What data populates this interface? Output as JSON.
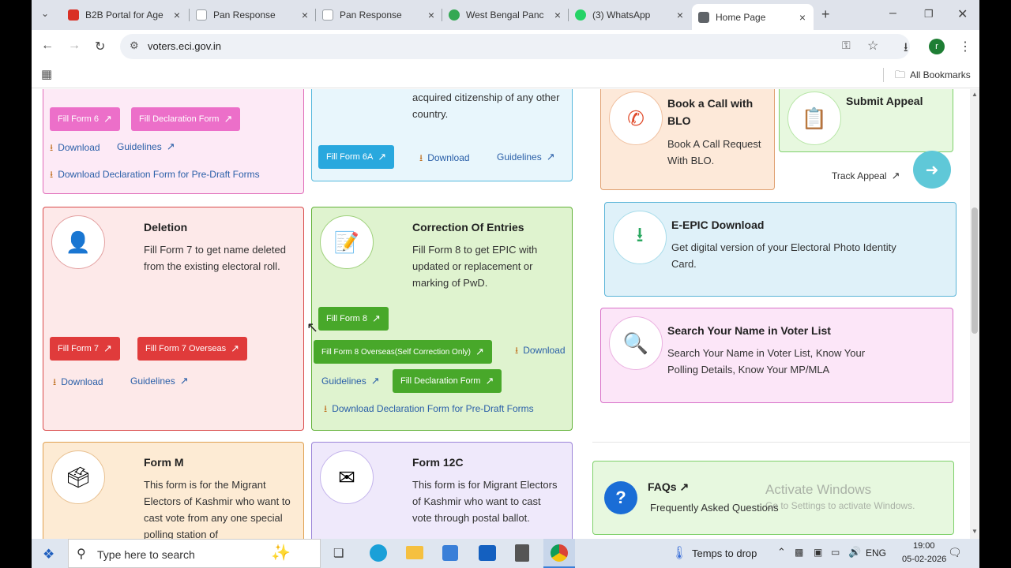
{
  "browser": {
    "tabs": [
      {
        "title": "B2B Portal for Age",
        "color": "#d93025"
      },
      {
        "title": "Pan Response",
        "color": "#9aa0a6"
      },
      {
        "title": "Pan Response",
        "color": "#9aa0a6"
      },
      {
        "title": "West Bengal Panc",
        "color": "#34a853"
      },
      {
        "title": "(3) WhatsApp",
        "color": "#25d366"
      },
      {
        "title": "Home Page",
        "color": "#5f6368"
      }
    ],
    "url": "voters.eci.gov.in",
    "bookmarks_label": "All Bookmarks",
    "profile_initial": "r"
  },
  "cards": {
    "form6": {
      "btn1": "Fill Form 6",
      "btn2": "Fill Declaration Form",
      "download": "Download",
      "guidelines": "Guidelines",
      "decl_download": "Download Declaration Form for Pre-Draft Forms"
    },
    "form6a": {
      "desc": "citizen of India and has not acquired citizenship of any other country.",
      "btn": "Fill Form 6A",
      "download": "Download",
      "guidelines": "Guidelines"
    },
    "deletion": {
      "title": "Deletion",
      "desc": "Fill Form 7 to get name deleted from the existing electoral roll.",
      "btn1": "Fill Form 7",
      "btn2": "Fill Form 7 Overseas",
      "download": "Download",
      "guidelines": "Guidelines"
    },
    "correction": {
      "title": "Correction Of Entries",
      "desc": "Fill Form 8 to get EPIC with updated or replacement or marking of PwD.",
      "btn1": "Fill Form 8",
      "btn2": "Fill Form 8 Overseas(Self Correction Only)",
      "download": "Download",
      "guidelines": "Guidelines",
      "btn3": "Fill Declaration Form",
      "decl_download": "Download Declaration Form for Pre-Draft Forms"
    },
    "formm": {
      "title": "Form M",
      "desc": "This form is for the Migrant Electors of Kashmir who want to cast vote from any one special polling station of"
    },
    "form12c": {
      "title": "Form 12C",
      "desc": "This form is for Migrant Electors of Kashmir who want to cast vote through postal ballot."
    },
    "blo": {
      "title": "Book a Call with BLO",
      "desc": "Book A Call Request With BLO."
    },
    "appeal": {
      "title": "Submit Appeal",
      "track": "Track Appeal"
    },
    "epic": {
      "title": "E-EPIC Download",
      "desc": "Get digital version of your Electoral Photo Identity Card."
    },
    "search": {
      "title": "Search Your Name in Voter List",
      "desc": "Search Your Name in Voter List, Know Your Polling Details, Know Your MP/MLA"
    },
    "faq": {
      "title": "FAQs",
      "desc": "Frequently Asked Questions"
    }
  },
  "watermark": {
    "line1": "Activate Windows",
    "line2": "Go to Settings to activate Windows."
  },
  "taskbar": {
    "search_placeholder": "Type here to search",
    "weather": "Temps to drop",
    "lang": "ENG",
    "time": "19:00",
    "date": "05-02-2026"
  }
}
